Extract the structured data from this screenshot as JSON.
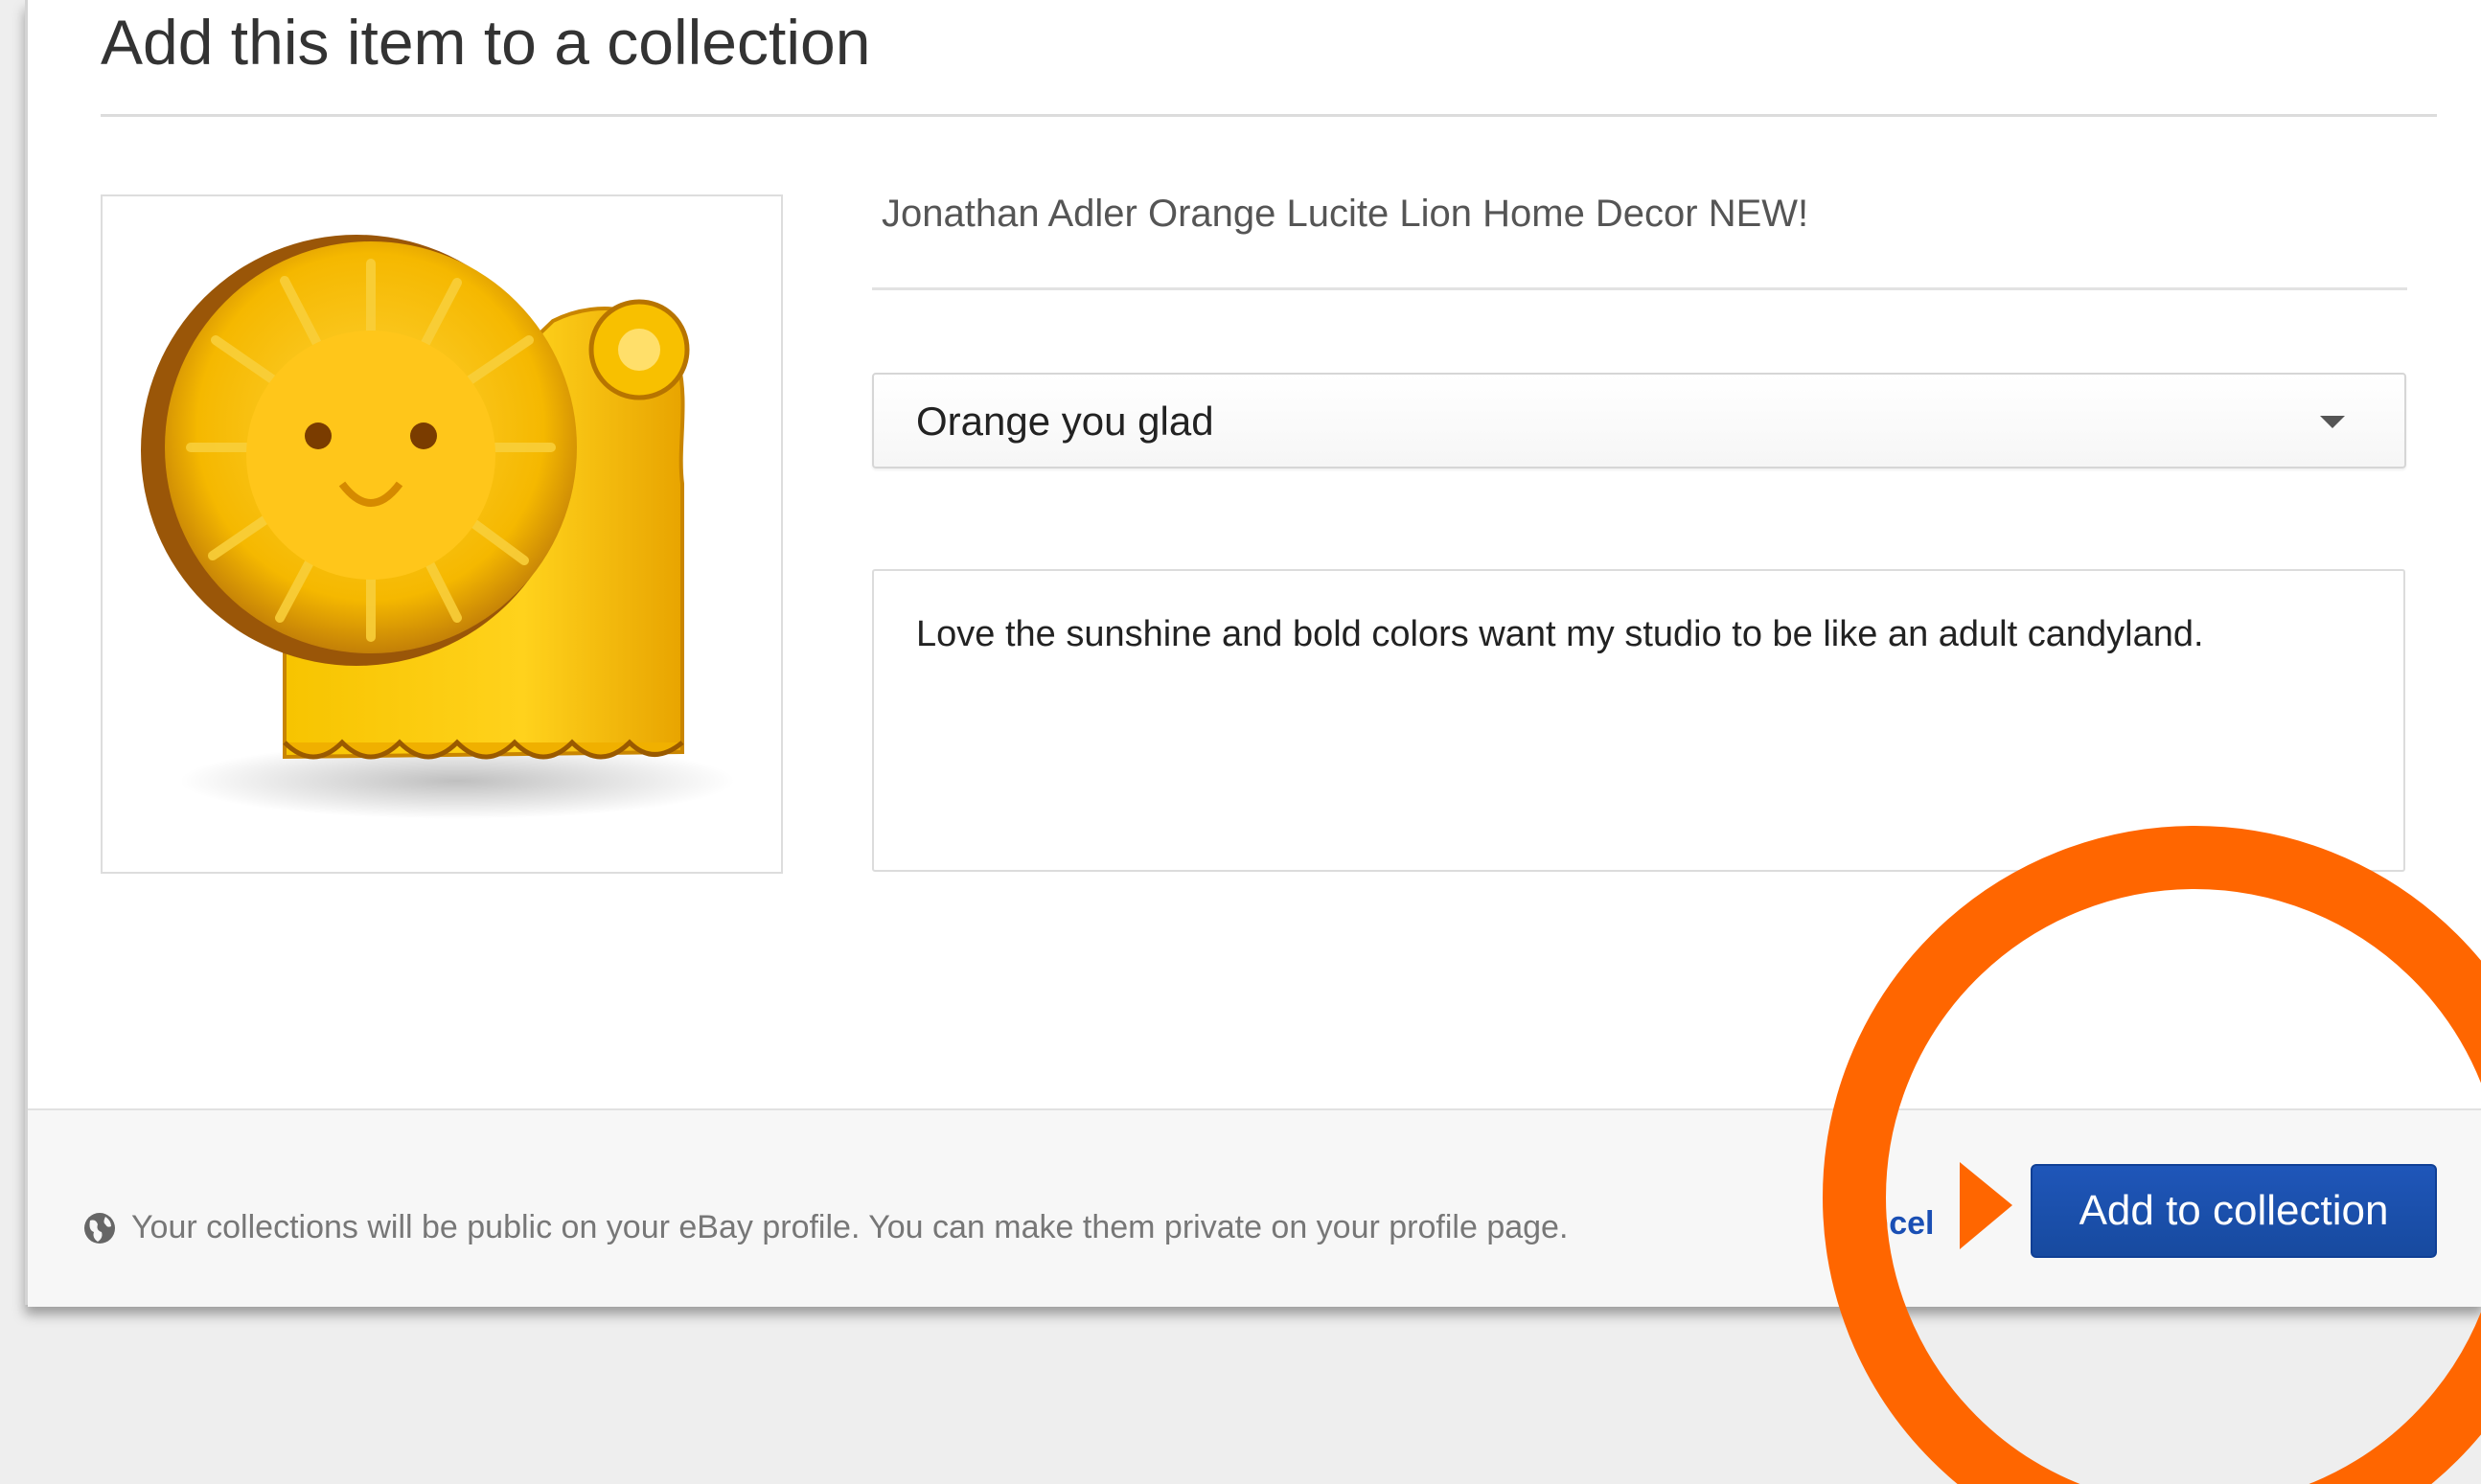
{
  "dialog": {
    "title": "Add this item to a collection"
  },
  "item": {
    "title": "Jonathan Adler Orange Lucite Lion Home Decor NEW!",
    "image_alt": "Orange lucite lion figurine"
  },
  "collection_select": {
    "selected": "Orange you glad"
  },
  "note": {
    "value": "Love the sunshine and bold colors want my studio to be like an adult candyland."
  },
  "footer": {
    "privacy_note": "Your collections will be public on your eBay profile. You can make them private on your profile page.",
    "cancel_label": "Cancel",
    "submit_label": "Add to collection"
  },
  "colors": {
    "primary_button": "#1a4fb4",
    "annotation": "#ff6600"
  }
}
